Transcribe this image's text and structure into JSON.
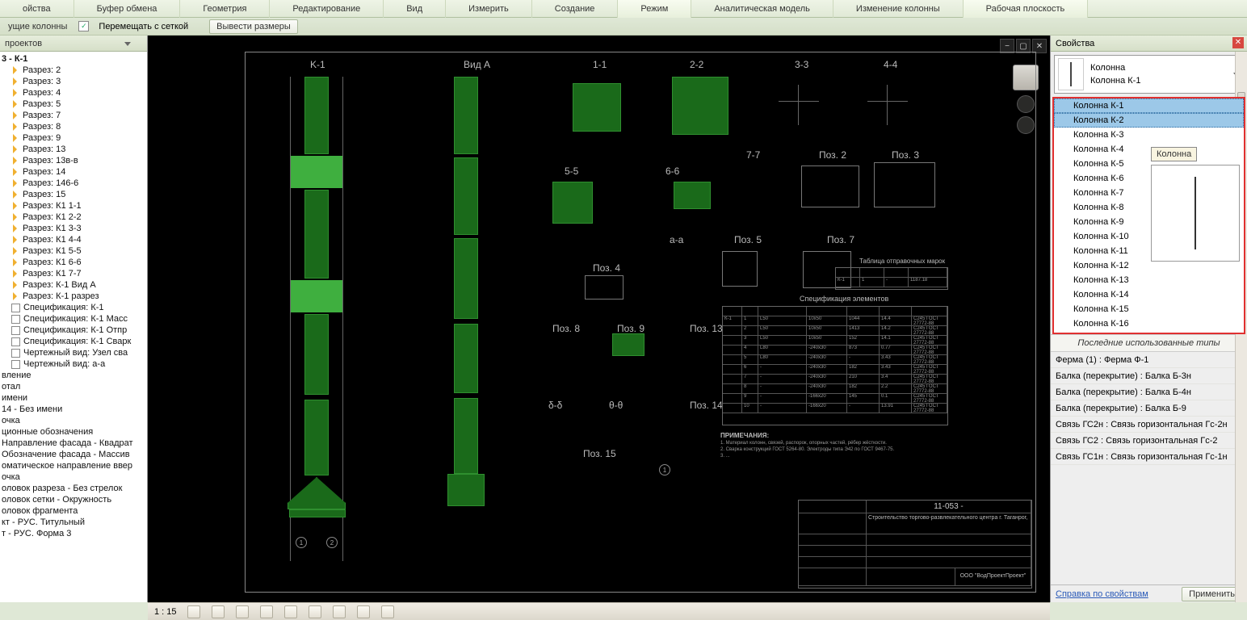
{
  "ribbon": {
    "tabs": [
      "ойства",
      "Буфер обмена",
      "Геометрия",
      "Редактирование",
      "Вид",
      "Измерить",
      "Создание",
      "Режим",
      "Аналитическая модель",
      "Изменение колонны",
      "Рабочая плоскость"
    ]
  },
  "options": {
    "prefix": "ущие колонны",
    "chk1_label": "Перемещать с сеткой",
    "btn1": "Вывести размеры"
  },
  "browser": {
    "title": "проектов",
    "group": "3 - К-1",
    "sections": [
      "Разрез: 2",
      "Разрез: 3",
      "Разрез: 4",
      "Разрез: 5",
      "Разрез: 7",
      "Разрез: 8",
      "Разрез: 9",
      "Разрез: 13",
      "Разрез: 13в-в",
      "Разрез: 14",
      "Разрез: 146-6",
      "Разрез: 15",
      "Разрез: К1 1-1",
      "Разрез: К1 2-2",
      "Разрез: К1 3-3",
      "Разрез: К1 4-4",
      "Разрез: К1 5-5",
      "Разрез: К1 6-6",
      "Разрез: К1 7-7",
      "Разрез: К-1 Вид А",
      "Разрез: К-1 разрез"
    ],
    "specs": [
      "Спецификация: К-1",
      "Спецификация: К-1 Масс",
      "Спецификация: К-1 Отпр",
      "Спецификация: К-1 Сварк",
      "Чертежный вид: Узел сва",
      "Чертежный вид: а-а"
    ],
    "other": [
      "вление",
      "отал",
      "имени",
      "14 - Без имени",
      "очка",
      "ционные обозначения",
      "Направление фасада - Квадрат",
      "Обозначение фасада - Массив",
      "оматическое направление ввер",
      "очка",
      "оловок разреза - Без стрелок",
      "оловок сетки - Окружность",
      "оловок фрагмента",
      "кт - РУС. Титульный",
      "т - РУС. Форма 3"
    ]
  },
  "canvas": {
    "labels": {
      "k1": "K-1",
      "vidA": "Вид А",
      "s11": "1-1",
      "s22": "2-2",
      "s33": "3-3",
      "s44": "4-4",
      "s55": "5-5",
      "s66": "6-6",
      "s77": "7-7",
      "s88": "δ-δ",
      "s99": "θ-θ",
      "aa": "a-a",
      "poz2": "Поз. 2",
      "poz3": "Поз. 3",
      "poz4": "Поз. 4",
      "poz5": "Поз. 5",
      "poz7": "Поз. 7",
      "poz8": "Поз. 8",
      "poz9": "Поз. 9",
      "poz13": "Поз. 13",
      "poz14": "Поз. 14",
      "poz15": "Поз. 15"
    },
    "spec_title": "Спецификация элементов",
    "tab_title": "Таблица отправочных марок",
    "note_title": "ПРИМЕЧАНИЯ:",
    "stamp1": "11-053 -",
    "stamp_org": "ООО \"ВодПроектПроект\"",
    "stamp_build": "Строительство торгово-развлекательного центра г. Таганрог,"
  },
  "status": {
    "scale": "1 : 15"
  },
  "props": {
    "title": "Свойства",
    "type_cat": "Колонна",
    "type_name": "Колонна К-1",
    "list": [
      "Колонна К-1",
      "Колонна К-2",
      "Колонна К-3",
      "Колонна К-4",
      "Колонна К-5",
      "Колонна К-6",
      "Колонна К-7",
      "Колонна К-8",
      "Колонна К-9",
      "Колонна К-10",
      "Колонна К-11",
      "Колонна К-12",
      "Колонна К-13",
      "Колонна К-14",
      "Колонна К-15",
      "Колонна К-16"
    ],
    "tooltip": "Колонна",
    "recent_head": "Последние использованные типы",
    "recent": [
      "Ферма (1) : Ферма Ф-1",
      "Балка (перекрытие) : Балка Б-3н",
      "Балка (перекрытие) : Балка Б-4н",
      "Балка (перекрытие) : Балка Б-9",
      "Связь ГС2н : Связь горизонтальная Гс-2н",
      "Связь ГС2 : Связь горизонтальная Гс-2",
      "Связь ГС1н : Связь горизонтальная Гс-1н"
    ],
    "help": "Справка по свойствам",
    "apply": "Применить"
  }
}
